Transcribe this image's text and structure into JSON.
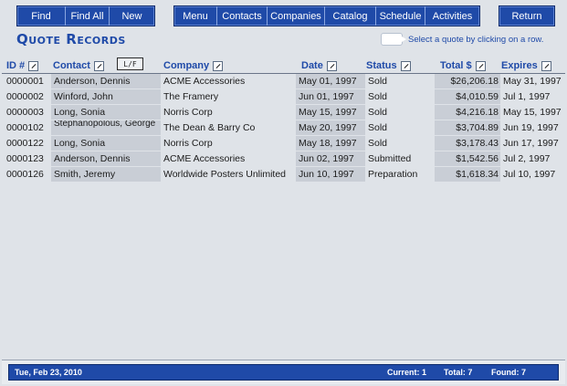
{
  "toolbar_left": {
    "find": "Find",
    "find_all": "Find All",
    "new": "New"
  },
  "toolbar_mid": {
    "menu": "Menu",
    "contacts": "Contacts",
    "companies": "Companies",
    "catalog": "Catalog",
    "schedule": "Schedule",
    "activities": "Activities"
  },
  "toolbar_right": {
    "return": "Return"
  },
  "page_title": "Quote Records",
  "hint": "Select a quote by clicking on a row.",
  "columns": {
    "id": "ID #",
    "contact": "Contact",
    "lf": "L/F",
    "company": "Company",
    "date": "Date",
    "status": "Status",
    "total": "Total $",
    "expires": "Expires"
  },
  "records": [
    {
      "id": "0000001",
      "contact": "Anderson, Dennis",
      "company": "ACME Accessories",
      "date": "May 01, 1997",
      "status": "Sold",
      "total": "$26,206.18",
      "expires": "May 31, 1997"
    },
    {
      "id": "0000002",
      "contact": "Winford, John",
      "company": "The Framery",
      "date": "Jun 01, 1997",
      "status": "Sold",
      "total": "$4,010.59",
      "expires": "Jul 1, 1997"
    },
    {
      "id": "0000003",
      "contact": "Long, Sonia",
      "company": "Norris Corp",
      "date": "May 15, 1997",
      "status": "Sold",
      "total": "$4,216.18",
      "expires": "May 15, 1997"
    },
    {
      "id": "0000102",
      "contact": "Stephanopolous, George",
      "company": "The Dean & Barry Co",
      "date": "May 20, 1997",
      "status": "Sold",
      "total": "$3,704.89",
      "expires": "Jun 19, 1997"
    },
    {
      "id": "0000122",
      "contact": "Long, Sonia",
      "company": "Norris Corp",
      "date": "May 18, 1997",
      "status": "Sold",
      "total": "$3,178.43",
      "expires": "Jun 17, 1997"
    },
    {
      "id": "0000123",
      "contact": "Anderson, Dennis",
      "company": "ACME Accessories",
      "date": "Jun 02, 1997",
      "status": "Submitted",
      "total": "$1,542.56",
      "expires": "Jul 2, 1997"
    },
    {
      "id": "0000126",
      "contact": "Smith, Jeremy",
      "company": "Worldwide Posters Unlimited",
      "date": "Jun 10, 1997",
      "status": "Preparation",
      "total": "$1,618.34",
      "expires": "Jul 10, 1997"
    }
  ],
  "status_bar": {
    "date": "Tue, Feb 23, 2010",
    "current": "Current: 1",
    "total": "Total: 7",
    "found": "Found: 7"
  },
  "colors": {
    "accent": "#1f4aa8",
    "background": "#dfe3e8",
    "highlight_column": "#c9ced6"
  }
}
